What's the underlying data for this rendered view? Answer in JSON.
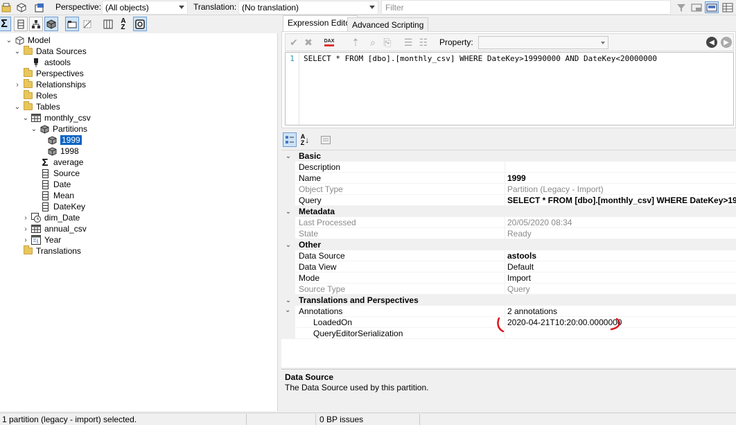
{
  "toolbar": {
    "perspective_label": "Perspective:",
    "perspective_value": "(All objects)",
    "translation_label": "Translation:",
    "translation_value": "(No translation)",
    "filter_placeholder": "Filter"
  },
  "tree": {
    "model": "Model",
    "data_sources": "Data Sources",
    "astools": "astools",
    "perspectives": "Perspectives",
    "relationships": "Relationships",
    "roles": "Roles",
    "tables": "Tables",
    "monthly_csv": "monthly_csv",
    "partitions": "Partitions",
    "p1999": "1999",
    "p1998": "1998",
    "average": "average",
    "source": "Source",
    "date": "Date",
    "mean": "Mean",
    "datekey": "DateKey",
    "dim_date": "dim_Date",
    "annual_csv": "annual_csv",
    "year": "Year",
    "translations": "Translations"
  },
  "tabs": {
    "expression_editor": "Expression Editor",
    "advanced_scripting": "Advanced Scripting"
  },
  "editor": {
    "property_label": "Property:",
    "dax_badge": "DAX",
    "line_number": "1",
    "code": "SELECT * FROM [dbo].[monthly_csv] WHERE DateKey>19990000 AND DateKey<20000000"
  },
  "properties": {
    "basic": "Basic",
    "description_name": "Description",
    "description_value": "",
    "name_name": "Name",
    "name_value": "1999",
    "object_type_name": "Object Type",
    "object_type_value": "Partition (Legacy - Import)",
    "query_name": "Query",
    "query_value": "SELECT * FROM [dbo].[monthly_csv] WHERE DateKey>19",
    "metadata": "Metadata",
    "last_processed_name": "Last Processed",
    "last_processed_value": "20/05/2020 08:34",
    "state_name": "State",
    "state_value": "Ready",
    "other": "Other",
    "data_source_name": "Data Source",
    "data_source_value": "astools",
    "data_view_name": "Data View",
    "data_view_value": "Default",
    "mode_name": "Mode",
    "mode_value": "Import",
    "source_type_name": "Source Type",
    "source_type_value": "Query",
    "translations": "Translations and Perspectives",
    "annotations_name": "Annotations",
    "annotations_value": "2 annotations",
    "loadedon_name": "LoadedOn",
    "loadedon_value": "2020-04-21T10:20:00.0000000",
    "qes_name": "QueryEditorSerialization",
    "qes_value": ""
  },
  "description_panel": {
    "title": "Data Source",
    "text": "The Data Source used by this partition."
  },
  "status_bar": {
    "selection": "1 partition (legacy - import) selected.",
    "issues": "0 BP issues"
  },
  "colors": {
    "selection": "#0a64c4",
    "annotation_mark": "#e0141e",
    "folder": "#e9c65b"
  }
}
